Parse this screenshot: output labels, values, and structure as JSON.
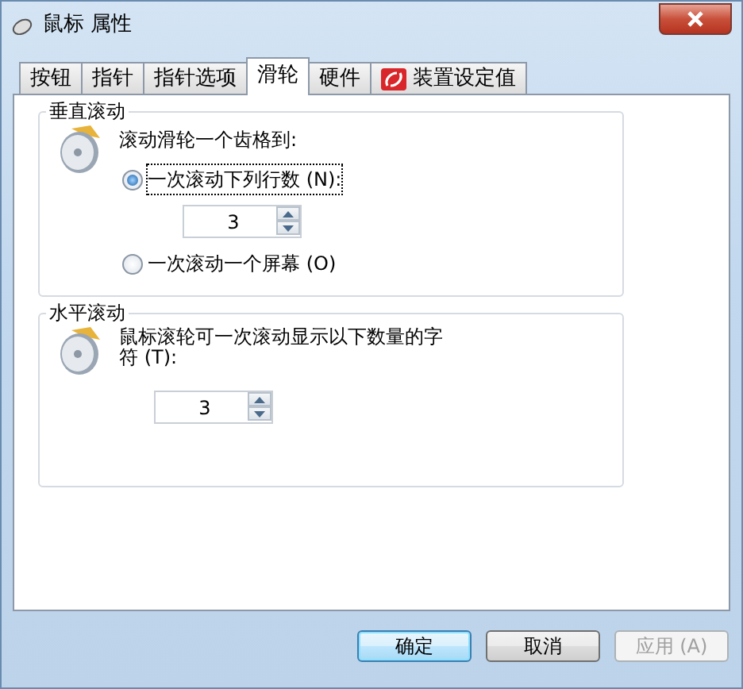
{
  "window": {
    "title": "鼠标 属性"
  },
  "tabs": [
    {
      "label": "按钮",
      "selected": false,
      "kind": "text"
    },
    {
      "label": "指针",
      "selected": false,
      "kind": "text"
    },
    {
      "label": "指针选项",
      "selected": false,
      "kind": "text"
    },
    {
      "label": "滑轮",
      "selected": true,
      "kind": "text"
    },
    {
      "label": "硬件",
      "selected": false,
      "kind": "text"
    },
    {
      "label": "装置设定值",
      "selected": false,
      "kind": "icon"
    }
  ],
  "vertical_scrolling": {
    "title": "垂直滚动",
    "prompt": "滚动滑轮一个齿格到:",
    "options": [
      {
        "label": "一次滚动下列行数 (N):",
        "selected": true,
        "focused": true,
        "spinner": {
          "value": "3"
        }
      },
      {
        "label": "一次滚动一个屏幕 (O)",
        "selected": false,
        "focused": false
      }
    ]
  },
  "horizontal_scrolling": {
    "title": "水平滚动",
    "prompt": "鼠标滚轮可一次滚动显示以下数量的字符 (T):",
    "spinner": {
      "value": "3"
    }
  },
  "buttons": [
    {
      "label": "确定",
      "default": true,
      "disabled": false
    },
    {
      "label": "取消",
      "default": false,
      "disabled": false
    },
    {
      "label": "应用 (A)",
      "default": false,
      "disabled": true
    }
  ]
}
